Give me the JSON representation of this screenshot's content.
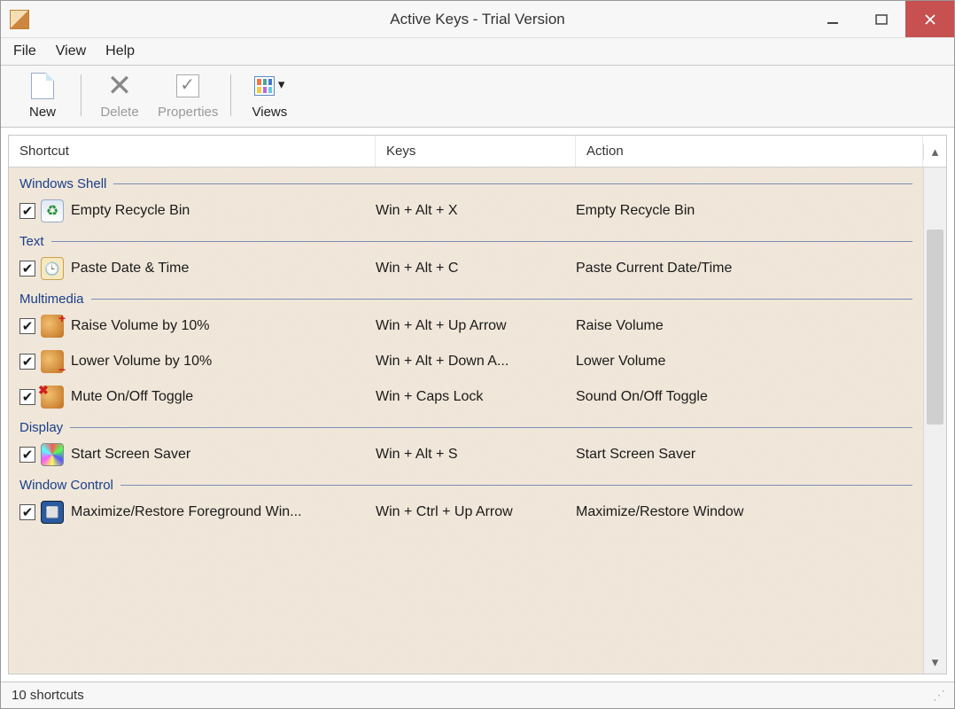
{
  "window": {
    "title": "Active Keys - Trial Version"
  },
  "menu": {
    "items": [
      "File",
      "View",
      "Help"
    ]
  },
  "toolbar": {
    "new": "New",
    "delete": "Delete",
    "properties": "Properties",
    "views": "Views"
  },
  "columns": {
    "shortcut": "Shortcut",
    "keys": "Keys",
    "action": "Action"
  },
  "groups": [
    {
      "name": "Windows Shell",
      "items": [
        {
          "checked": true,
          "icon": "recycle",
          "shortcut": "Empty Recycle Bin",
          "keys": "Win + Alt + X",
          "action": "Empty Recycle Bin"
        }
      ]
    },
    {
      "name": "Text",
      "items": [
        {
          "checked": true,
          "icon": "clock",
          "shortcut": "Paste Date & Time",
          "keys": "Win + Alt + C",
          "action": "Paste Current Date/Time"
        }
      ]
    },
    {
      "name": "Multimedia",
      "items": [
        {
          "checked": true,
          "icon": "volup",
          "shortcut": "Raise Volume by 10%",
          "keys": "Win + Alt + Up Arrow",
          "action": "Raise Volume"
        },
        {
          "checked": true,
          "icon": "voldown",
          "shortcut": "Lower Volume by 10%",
          "keys": "Win + Alt + Down A...",
          "action": "Lower Volume"
        },
        {
          "checked": true,
          "icon": "mute",
          "shortcut": "Mute On/Off Toggle",
          "keys": "Win + Caps Lock",
          "action": "Sound On/Off Toggle"
        }
      ]
    },
    {
      "name": "Display",
      "items": [
        {
          "checked": true,
          "icon": "saver",
          "shortcut": "Start Screen Saver",
          "keys": "Win + Alt + S",
          "action": "Start Screen Saver"
        }
      ]
    },
    {
      "name": "Window Control",
      "items": [
        {
          "checked": true,
          "icon": "max",
          "shortcut": "Maximize/Restore Foreground Win...",
          "keys": "Win + Ctrl + Up Arrow",
          "action": "Maximize/Restore Window"
        }
      ]
    }
  ],
  "status": {
    "text": "10 shortcuts"
  }
}
